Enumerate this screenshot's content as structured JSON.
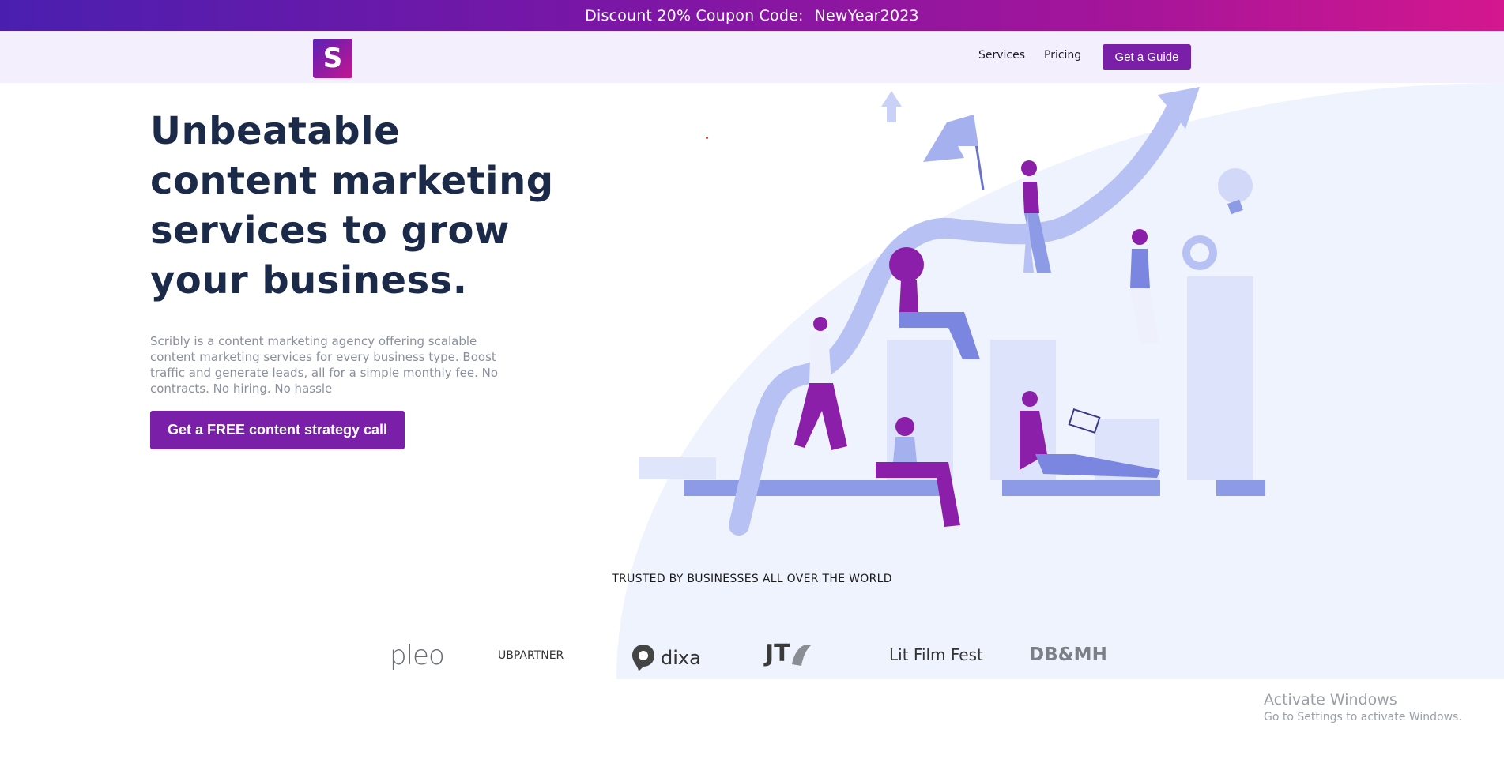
{
  "promo": {
    "text": "Discount 20% Coupon Code:",
    "code": "NewYear2023"
  },
  "nav": {
    "logo_letter": "S",
    "links": [
      "Services",
      "Pricing"
    ],
    "cta": "Get a Guide"
  },
  "hero": {
    "title": "Unbeatable content marketing services to grow your business.",
    "description": "Scribly is a content marketing agency offering scalable content marketing services for every business type. Boost traffic and generate leads, all for a simple monthly fee. No contracts. No hiring. No hassle",
    "cta": "Get a FREE content strategy call"
  },
  "trusted": {
    "heading": "TRUSTED BY BUSINESSES ALL OVER THE WORLD",
    "brands": [
      "pleo",
      "UBPARTNER",
      "dixa",
      "JT",
      "Lit Film Fest",
      "DB&MH"
    ]
  },
  "windows": {
    "title": "Activate Windows",
    "subtitle": "Go to Settings to activate Windows."
  },
  "colors": {
    "primary": "#7a1fa8",
    "heading": "#1c2a4a",
    "hero_bg": "#eef3fd",
    "nav_bg": "#f3effc"
  }
}
